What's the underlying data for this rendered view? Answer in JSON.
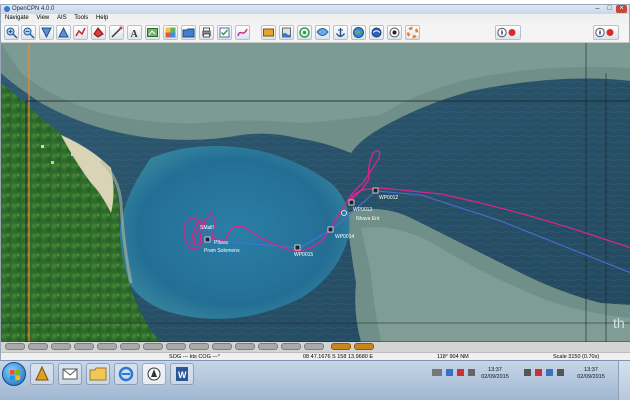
{
  "window": {
    "title": "OpenCPN 4.0.0"
  },
  "menu": {
    "items": [
      "Navigate",
      "View",
      "AIS",
      "Tools",
      "Help"
    ]
  },
  "toolbar": {
    "buttons": [
      "zoom-in-icon",
      "zoom-out-icon",
      "scale-in-icon",
      "scale-out-icon",
      "route-icon",
      "ship-icon",
      "measure-icon",
      "text-icon",
      "chart-toggle-icon",
      "quilt-icon",
      "folder-icon",
      "print-icon",
      "route-manager-icon",
      "track-icon",
      "color-scheme-icon",
      "tide-icon",
      "current-icon",
      "anchor-icon",
      "ais-icon",
      "globe-icon",
      "settings-icon",
      "lifebuoy-icon"
    ],
    "compass_left_icon": "compass-gps-icon",
    "compass_right_icon": "compass-gps-icon"
  },
  "chart": {
    "waypoints": [
      "SMall!",
      "Pflava",
      "Pram Solomons",
      "WP0015",
      "WP0014",
      "Nhava Ent",
      "WP0013",
      "WP0012"
    ],
    "watermark": "th",
    "track_color": "#d6268c",
    "route_color": "#4a6fd6"
  },
  "piano": {
    "selected_index": 11,
    "count": 13
  },
  "status": {
    "sog_cog": "SOG --- kts  COG ---°",
    "position": "08 47.1676 S    158 13.9680 E",
    "bearing": "118°   904 NM",
    "scale": "Scale 3150 (0.70x)"
  },
  "taskbar": {
    "items": [
      "start-orb-icon",
      "winamp-icon",
      "mail-icon",
      "explorer-folder-icon",
      "ie-icon",
      "opencpn-icon",
      "word-icon"
    ],
    "clock_left": {
      "time": "13:37",
      "date": "02/09/2015"
    },
    "clock_right": {
      "time": "13:37",
      "date": "02/09/2015"
    }
  }
}
